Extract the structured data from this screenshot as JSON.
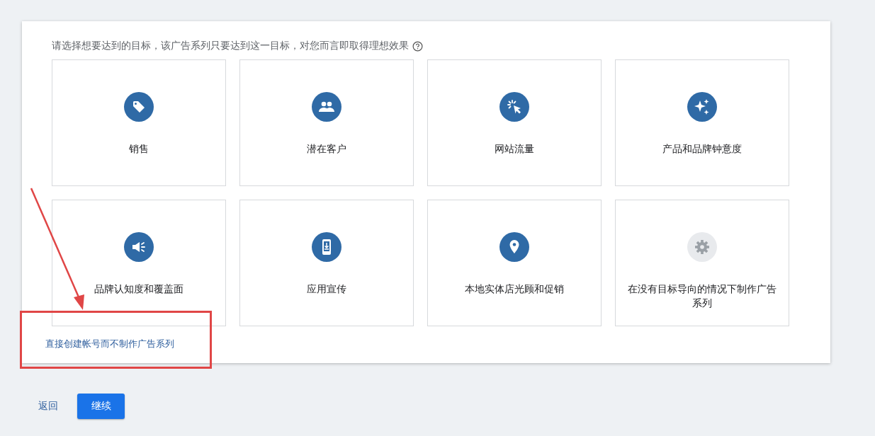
{
  "prompt": {
    "text": "请选择想要达到的目标，该广告系列只要达到这一目标，对您而言即取得理想效果"
  },
  "goals": [
    {
      "kind": "tag",
      "label": "销售"
    },
    {
      "kind": "people",
      "label": "潜在客户"
    },
    {
      "kind": "click",
      "label": "网站流量"
    },
    {
      "kind": "sparkle",
      "label": "产品和品牌钟意度"
    },
    {
      "kind": "megaphone",
      "label": "品牌认知度和覆盖面"
    },
    {
      "kind": "phone",
      "label": "应用宣传"
    },
    {
      "kind": "pin",
      "label": "本地实体店光顾和促销"
    },
    {
      "kind": "gear",
      "label": "在没有目标导向的情况下制作广告系列"
    }
  ],
  "skip_link": "直接创建帐号而不制作广告系列",
  "buttons": {
    "back": "返回",
    "continue": "继续"
  }
}
